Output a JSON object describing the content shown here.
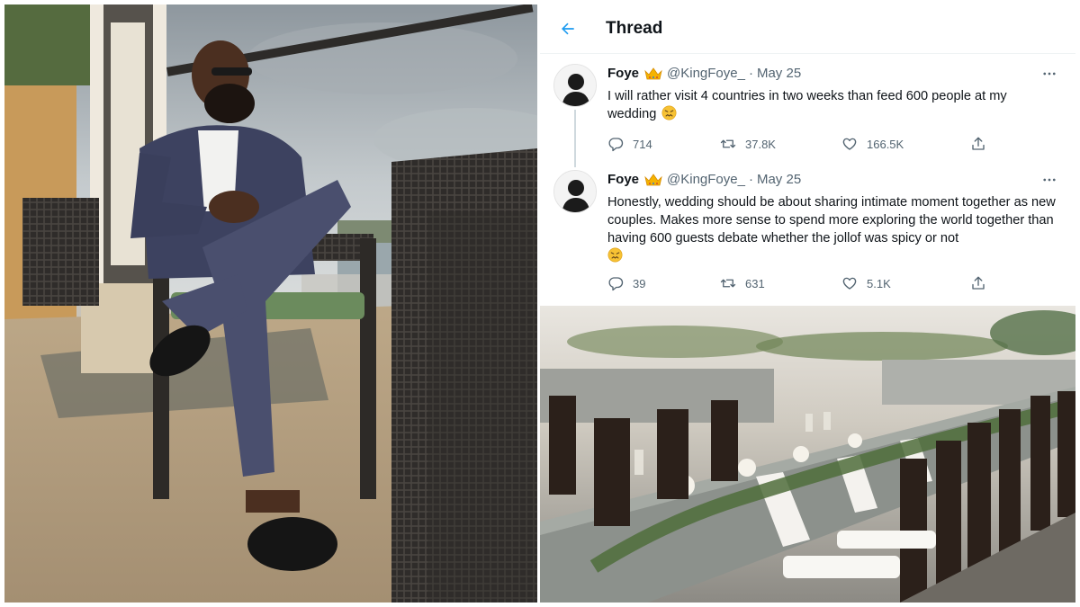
{
  "thread": {
    "title": "Thread",
    "tweets": [
      {
        "name": "Foye",
        "handle": "@KingFoye_",
        "separator": "·",
        "date": "May 25",
        "text": "I will rather visit 4 countries in two weeks than feed 600 people at my wedding",
        "emoji": "confounded-face",
        "replies": "714",
        "retweets": "37.8K",
        "likes": "166.5K"
      },
      {
        "name": "Foye",
        "handle": "@KingFoye_",
        "separator": "·",
        "date": "May 25",
        "text": "Honestly, wedding should be about sharing intimate moment together as new couples. Makes more sense to spend more exploring the world together than having 600 guests debate whether the jollof was spicy or not",
        "emoji": "confounded-face",
        "replies": "39",
        "retweets": "631",
        "likes": "5.1K"
      }
    ]
  },
  "icons": {
    "back": "arrow-left-icon",
    "more": "more-horizontal-icon",
    "reply": "reply-icon",
    "retweet": "retweet-icon",
    "like": "heart-icon",
    "share": "share-icon",
    "badge": "crown-icon"
  },
  "colors": {
    "accent": "#1d9bf0",
    "text": "#0f1419",
    "secondary": "#536471",
    "divider": "#eff3f4",
    "crown": "#f5b301"
  }
}
